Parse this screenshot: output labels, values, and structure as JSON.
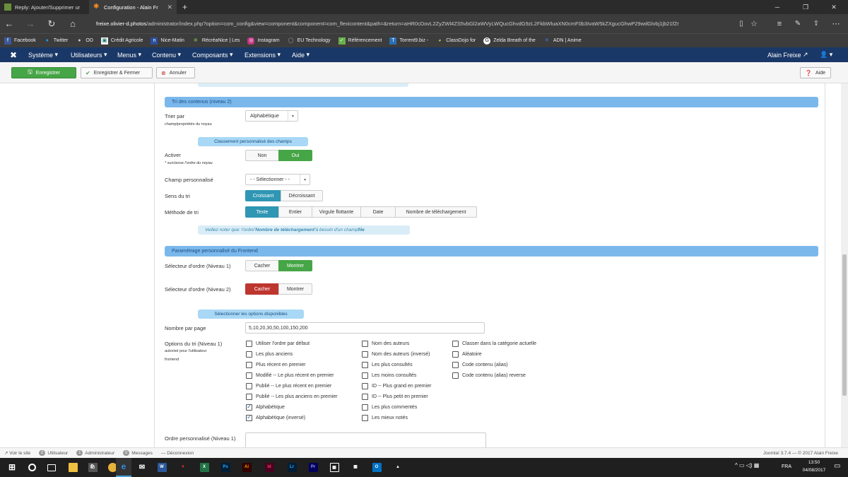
{
  "browser": {
    "tabs": [
      {
        "label": "Reply: Ajouter/Supprimer ur",
        "active": false
      },
      {
        "label": "Configuration - Alain Fr",
        "active": true
      }
    ],
    "new_tab": "+",
    "url_host": "freixe.olivier-d.photos",
    "url_path": "/administrator/index.php?option=com_config&view=component&component=com_flexicontent&path=&return=aHR0cDovL2ZyZWl4ZS5vbGl2aWVyLWQucGhvdG9zL2FkbWluaXN0cmF0b3IvaW5kZXgucGhwP29wdGlvbj1jb21fZr",
    "bookmarks": [
      "Facebook",
      "Twitter",
      "OD",
      "Crédit Agricole",
      "Nice-Matin",
      "RécréaNice | Les",
      "Instagram",
      "EU Technology",
      "Référencement",
      "Torrent9.biz -",
      "ClassDojo for",
      "Zelda Breath of the",
      "ADN | Anime"
    ]
  },
  "joomla": {
    "menu": [
      "Système",
      "Utilisateurs",
      "Menus",
      "Contenu",
      "Composants",
      "Extensions",
      "Aide"
    ],
    "user": "Alain Freixe",
    "toolbar": {
      "save": "Enregistrer",
      "save_close": "Enregistrer & Fermer",
      "cancel": "Annuler",
      "help": "Aide"
    }
  },
  "form": {
    "section1": "Tri des contenus (niveau 2)",
    "trier_par_label": "Trier par",
    "trier_par_hint": "champ/propriétés du noyau",
    "trier_par_value": "Alphabétique",
    "sub1": "Classement personnalisé des champs",
    "activer_label": "Activer",
    "activer_hint": "* surclasse l'ordre du noyau",
    "activer_opts": [
      "Non",
      "Oui"
    ],
    "champ_label": "Champ personnalisé",
    "champ_value": "- - Sélectionner - -",
    "sens_label": "Sens du tri",
    "sens_opts": [
      "Croissant",
      "Décroissant"
    ],
    "methode_label": "Méthode de tri",
    "methode_opts": [
      "Texte",
      "Entier",
      "Virgule flottante",
      "Date",
      "Nombre de téléchargement"
    ],
    "note_pre": "Veillez noter que: l'ordre ",
    "note_b1": "'Nombre de téléchargement'",
    "note_mid": " à besoin d'un champ ",
    "note_b2": "file",
    "section2": "Paramétrage personnalisé du Frontend",
    "sel1_label": "Sélecteur d'ordre (Niveau 1)",
    "sel2_label": "Sélecteur d'ordre (Niveau 2)",
    "showhide_opts": [
      "Cacher",
      "Montrer"
    ],
    "sub2": "Sélectionner les options disponibles",
    "nb_label": "Nombre par page",
    "nb_value": "5,10,20,30,50,100,150,200",
    "options_label": "Options du tri (Niveau 1)",
    "options_hint1": "autorisé pour l'utilisateur",
    "options_hint2": "frontend",
    "col1": [
      {
        "t": "Utiliser l'ordre par défaut",
        "c": false
      },
      {
        "t": "Les plus anciens",
        "c": false
      },
      {
        "t": "Plus récent en premier",
        "c": false
      },
      {
        "t": "Modifié -- Le plus récent en premier",
        "c": false
      },
      {
        "t": "Publié -- Le plus récent en premier",
        "c": false
      },
      {
        "t": "Publié -- Les plus anciens en premier",
        "c": false
      },
      {
        "t": "Alphabétique",
        "c": true
      },
      {
        "t": "Alphabétique (inversé)",
        "c": true
      }
    ],
    "col2": [
      {
        "t": "Nom des auteurs",
        "c": false
      },
      {
        "t": "Nom des auteurs (inversé)",
        "c": false
      },
      {
        "t": "Les plus consultés",
        "c": false
      },
      {
        "t": "Les moins consultés",
        "c": false
      },
      {
        "t": "ID -- Plus grand en premier",
        "c": false
      },
      {
        "t": "ID -- Plus petit en premier",
        "c": false
      },
      {
        "t": "Les plus commentés",
        "c": false
      },
      {
        "t": "Les mieux notés",
        "c": false
      }
    ],
    "col3": [
      {
        "t": "Classer dans la catégorie actuelle",
        "c": false
      },
      {
        "t": "Aléatoire",
        "c": false
      },
      {
        "t": "Code contenu (alias)",
        "c": false
      },
      {
        "t": "Code contenu (alias) reverse",
        "c": false
      }
    ],
    "ordre_label": "Ordre personnalisé (Niveau 1)"
  },
  "footer": {
    "voir": "Voir le site",
    "u_count": "0",
    "u_label": "Utilisateur",
    "a_count": "1",
    "a_label": "Administrateur",
    "m_count": "0",
    "m_label": "Messages",
    "logout": "Déconnexion",
    "version": "Joomla! 3.7.4 — © 2017 Alain Freixe"
  },
  "taskbar": {
    "lang": "FRA",
    "time": "13:50",
    "date": "04/08/2017"
  },
  "colors": {
    "joomla_nav": "#1a3867",
    "green": "#46a546",
    "blue": "#2f96b4",
    "red": "#bd362f",
    "section": "#7ab8ec"
  }
}
